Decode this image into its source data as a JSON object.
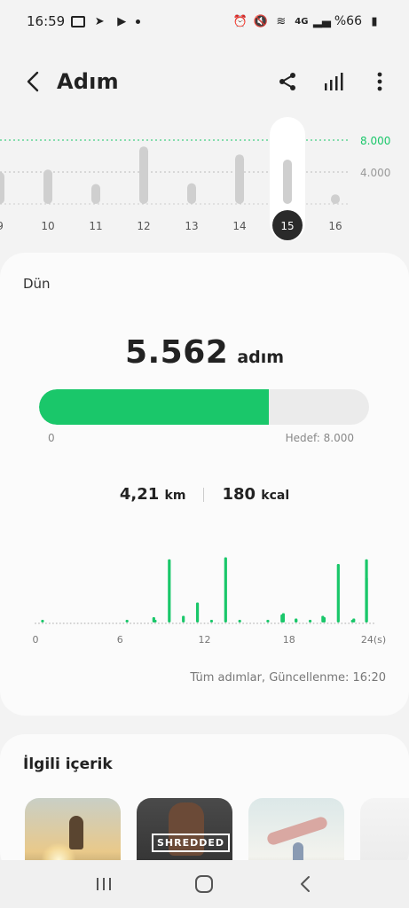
{
  "status_bar": {
    "time": "16:59",
    "battery_text": "%66"
  },
  "app_bar": {
    "title": "Adım"
  },
  "weekly_chart": {
    "goal_value": 8000,
    "goal_label": "8.000",
    "mid_label": "4.000",
    "selected_day": "15",
    "days": [
      "9",
      "10",
      "11",
      "12",
      "13",
      "14",
      "15",
      "16"
    ],
    "values": [
      4000,
      4300,
      2500,
      7200,
      2600,
      6200,
      5562,
      1200
    ],
    "colors": {
      "bar": "#cfcfcf",
      "goal": "#1ac76a",
      "selected": "#2a2a2a"
    }
  },
  "daily": {
    "day_label": "Dün",
    "steps_value": "5.562",
    "steps_unit": "adım",
    "progress_fraction": 0.695,
    "progress_min": "0",
    "progress_goal": "Hedef: 8.000",
    "distance_value": "4,21",
    "distance_unit": "km",
    "calories_value": "180",
    "calories_unit": "kcal",
    "updated_text": "Tüm adımlar, Güncellenme: 16:20"
  },
  "chart_data": {
    "type": "bar",
    "x_ticks": [
      "0",
      "6",
      "12",
      "18",
      "24(s)"
    ],
    "ylim": [
      0,
      100
    ],
    "hours": [
      0,
      1,
      2,
      3,
      4,
      5,
      6,
      7,
      8,
      9,
      10,
      11,
      12,
      13,
      14,
      15,
      16,
      17,
      18,
      19,
      20,
      21,
      22,
      23
    ],
    "values": [
      2,
      0,
      0,
      0,
      0,
      0,
      2,
      0,
      3,
      95,
      10,
      30,
      3,
      98,
      2,
      0,
      3,
      12,
      6,
      4,
      8,
      88,
      2,
      95
    ],
    "extra_bars": [
      {
        "x": 8.4,
        "value": 8
      },
      {
        "x": 20.4,
        "value": 10
      },
      {
        "x": 22.6,
        "value": 6
      },
      {
        "x": 23.5,
        "value": 68
      },
      {
        "x": 17.6,
        "value": 14
      },
      {
        "x": 18.5,
        "value": 5
      }
    ],
    "bar_color": "#1ac76a"
  },
  "related": {
    "title": "İlgili içerik",
    "thumb2_label": "SHREDDED"
  }
}
